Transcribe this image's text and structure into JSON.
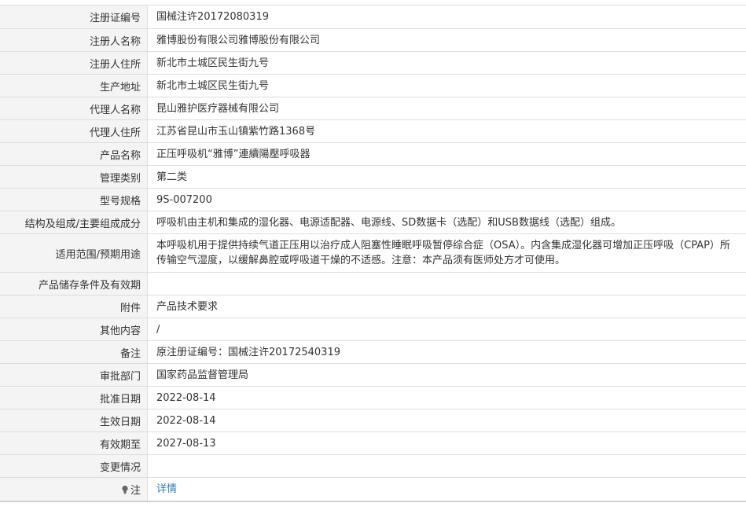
{
  "rows": [
    {
      "label": "注册证编号",
      "value": "国械注许20172080319"
    },
    {
      "label": "注册人名称",
      "value": "雅博股份有限公司雅博股份有限公司"
    },
    {
      "label": "注册人住所",
      "value": "新北市土城区民生街九号"
    },
    {
      "label": "生产地址",
      "value": "新北市土城区民生街九号"
    },
    {
      "label": "代理人名称",
      "value": "昆山雅护医疗器械有限公司"
    },
    {
      "label": "代理人住所",
      "value": "江苏省昆山市玉山镇紫竹路1368号"
    },
    {
      "label": "产品名称",
      "value": "正压呼吸机“雅博”連續陽壓呼吸器"
    },
    {
      "label": "管理类别",
      "value": "第二类"
    },
    {
      "label": "型号规格",
      "value": "9S-007200"
    },
    {
      "label": "结构及组成/主要组成成分",
      "value": "呼吸机由主机和集成的湿化器、电源适配器、电源线、SD数据卡（选配）和USB数据线（选配）组成。"
    },
    {
      "label": "适用范围/预期用途",
      "value": "本呼吸机用于提供持续气道正压用以治疗成人阻塞性睡眠呼吸暂停综合症（OSA）。内含集成湿化器可增加正压呼吸（CPAP）所传输空气湿度，以缓解鼻腔或呼吸道干燥的不适感。注意：本产品须有医师处方才可使用。"
    },
    {
      "label": "产品储存条件及有效期",
      "value": ""
    },
    {
      "label": "附件",
      "value": "产品技术要求"
    },
    {
      "label": "其他内容",
      "value": "/"
    },
    {
      "label": "备注",
      "value": "原注册证编号：国械注许20172540319"
    },
    {
      "label": "审批部门",
      "value": "国家药品监督管理局"
    },
    {
      "label": "批准日期",
      "value": "2022-08-14"
    },
    {
      "label": "生效日期",
      "value": "2022-08-14"
    },
    {
      "label": "有效期至",
      "value": "2027-08-13"
    },
    {
      "label": "变更情况",
      "value": ""
    }
  ],
  "note": {
    "label": "注",
    "link": "详情",
    "icon": "lightbulb-icon"
  }
}
